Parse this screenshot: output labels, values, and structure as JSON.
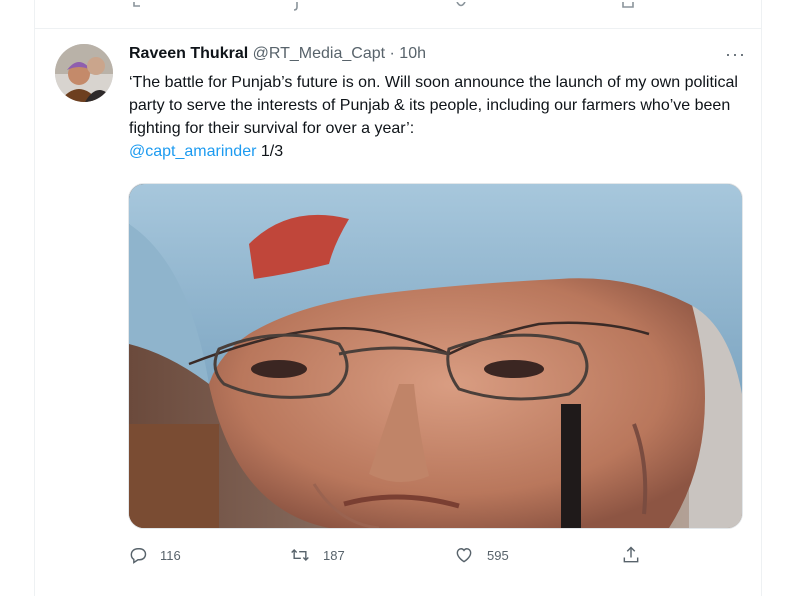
{
  "tweet": {
    "author_name": "Raveen Thukral",
    "handle": "@RT_Media_Capt",
    "separator": "·",
    "time": "10h",
    "text": "‘The battle for Punjab’s future is on. Will soon announce the launch of my own political party to serve the interests of Punjab & its people, including our farmers who’ve been fighting for their survival for over a year’:",
    "mention": "@capt_amarinder",
    "thread_marker": "1/3",
    "more_glyph": "···"
  },
  "actions": {
    "reply_count": "116",
    "retweet_count": "187",
    "like_count": "595"
  },
  "icons": {
    "reply": "reply-icon",
    "retweet": "retweet-icon",
    "like": "heart-icon",
    "share": "share-icon",
    "more": "more-options-icon"
  },
  "colors": {
    "link": "#1d9bf0",
    "secondary_text": "#58636b",
    "primary_text": "#0f1419"
  }
}
